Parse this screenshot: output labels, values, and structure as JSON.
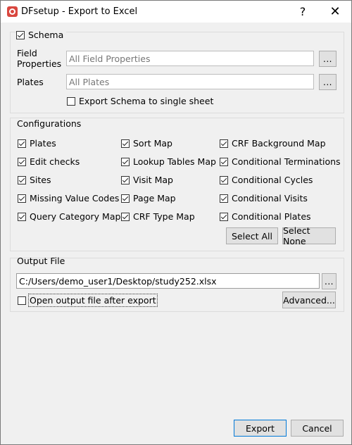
{
  "window": {
    "title": "DFsetup - Export to Excel",
    "help_label": "?",
    "close_label": "✕",
    "app_icon": "dfsetup-app-icon"
  },
  "schema": {
    "label": "Schema",
    "checked": true,
    "field_properties_label": "Field\nProperties",
    "field_properties_placeholder": "All Field Properties",
    "plates_label": "Plates",
    "plates_placeholder": "All Plates",
    "browse_label": "...",
    "single_sheet_label": "Export Schema to single sheet",
    "single_sheet_checked": false
  },
  "configurations": {
    "title": "Configurations",
    "items": [
      {
        "label": "Plates",
        "checked": true
      },
      {
        "label": "Edit checks",
        "checked": true
      },
      {
        "label": "Sites",
        "checked": true
      },
      {
        "label": "Missing Value Codes",
        "checked": true
      },
      {
        "label": "Query Category Map",
        "checked": true
      },
      {
        "label": "Sort Map",
        "checked": true
      },
      {
        "label": "Lookup Tables Map",
        "checked": true
      },
      {
        "label": "Visit Map",
        "checked": true
      },
      {
        "label": "Page Map",
        "checked": true
      },
      {
        "label": "CRF Type Map",
        "checked": true
      },
      {
        "label": "CRF Background Map",
        "checked": true
      },
      {
        "label": "Conditional Terminations",
        "checked": true
      },
      {
        "label": "Conditional Cycles",
        "checked": true
      },
      {
        "label": "Conditional Visits",
        "checked": true
      },
      {
        "label": "Conditional Plates",
        "checked": true
      }
    ],
    "select_all_label": "Select All",
    "select_none_label": "Select None"
  },
  "output": {
    "title": "Output File",
    "path": "C:/Users/demo_user1/Desktop/study252.xlsx",
    "browse_label": "...",
    "open_after_label": "Open output file after export",
    "open_after_checked": false,
    "advanced_label": "Advanced..."
  },
  "footer": {
    "export_label": "Export",
    "cancel_label": "Cancel"
  }
}
